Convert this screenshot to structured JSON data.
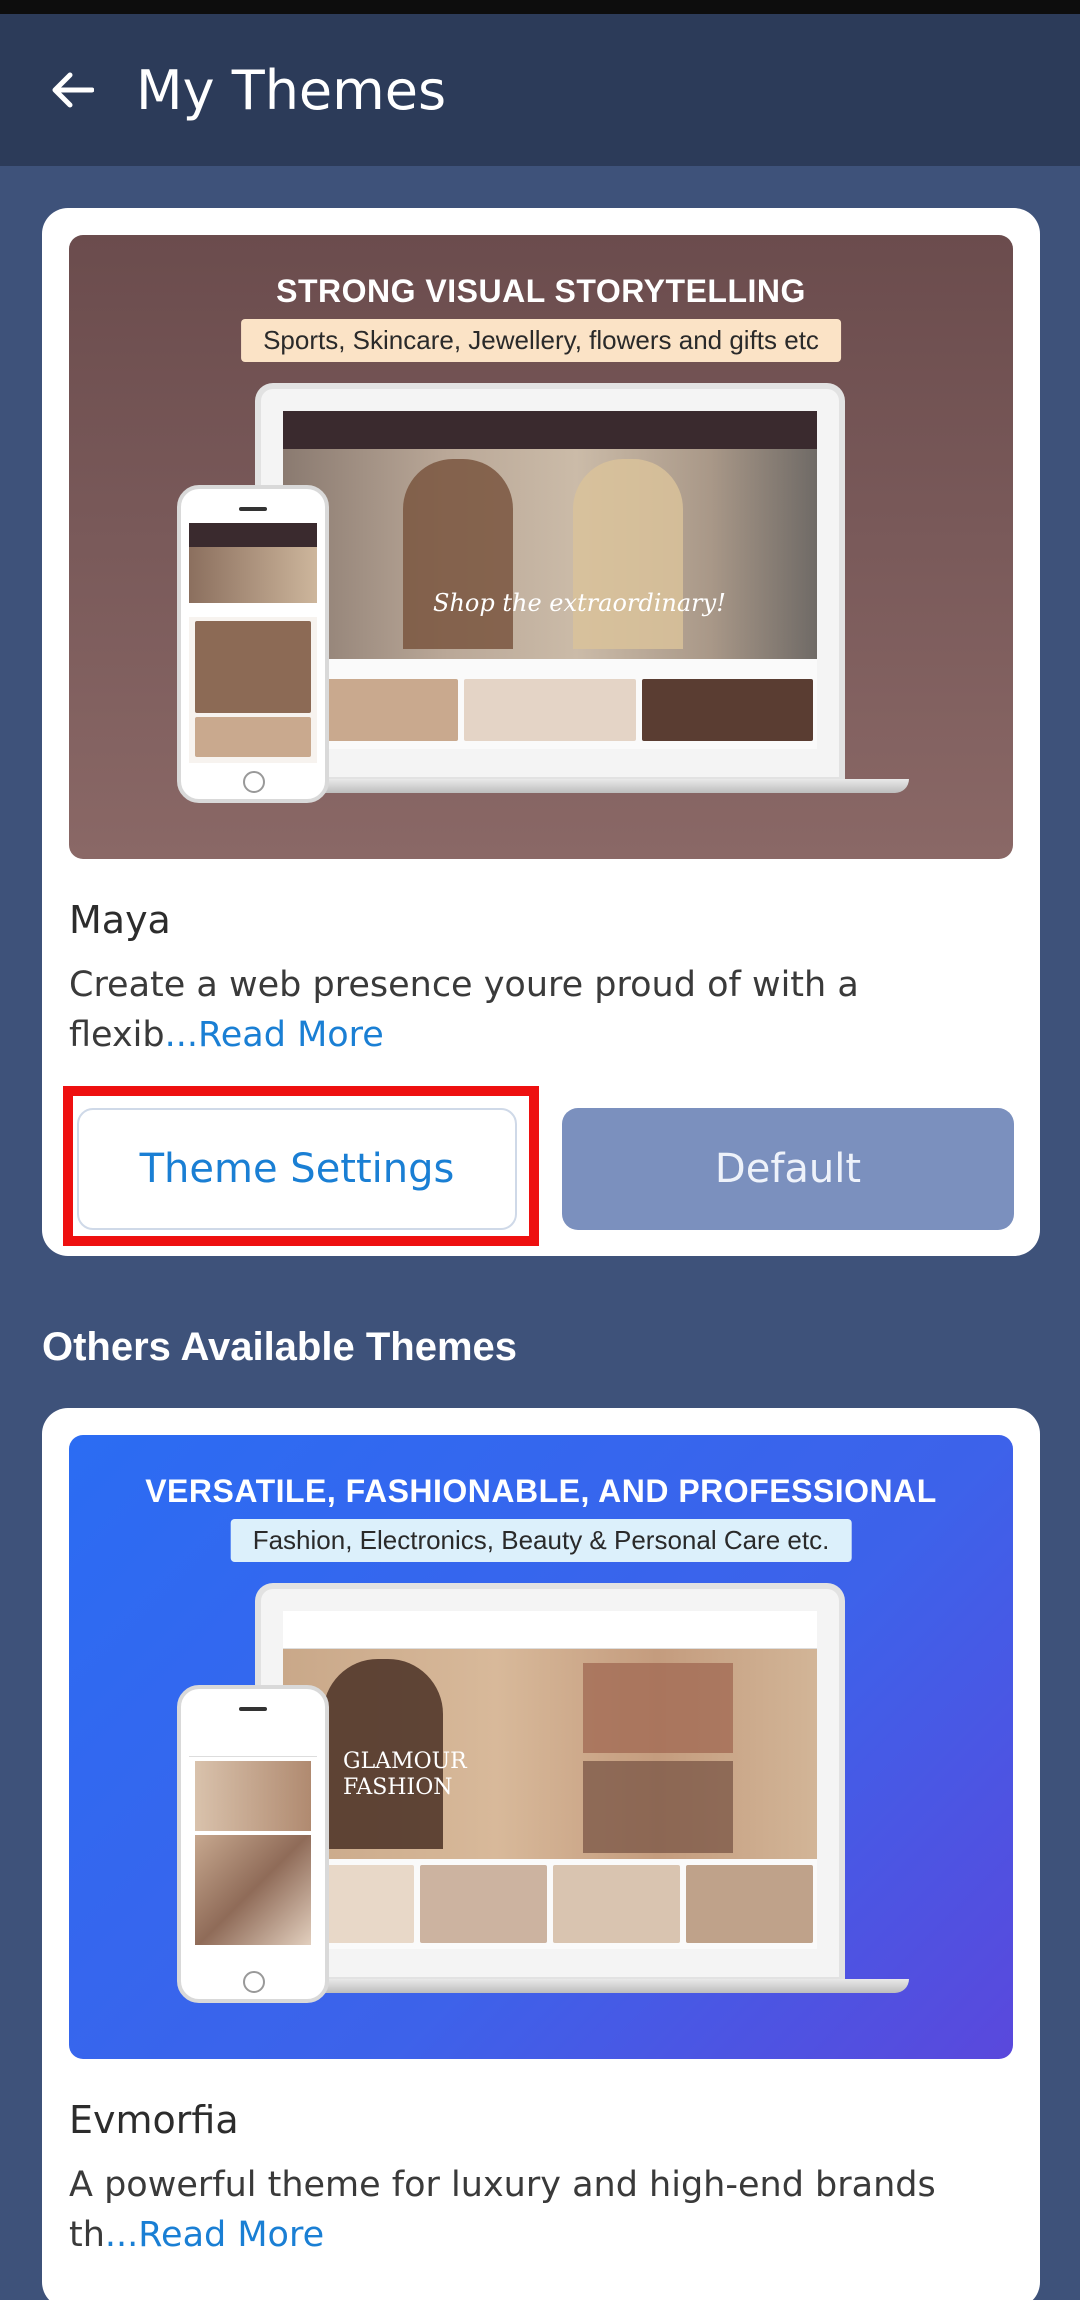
{
  "header": {
    "title": "My Themes",
    "back_icon": "arrow-left-icon"
  },
  "current_theme": {
    "banner": {
      "headline": "STRONG VISUAL STORYTELLING",
      "tagline": "Sports, Skincare, Jewellery, flowers and gifts etc",
      "hero_caption": "Shop the extraordinary!"
    },
    "name": "Maya",
    "description": "Create a web presence youre proud of with a flexib",
    "read_more": "...Read More",
    "settings_button": "Theme Settings",
    "default_button": "Default"
  },
  "others_section": {
    "title": "Others Available Themes"
  },
  "other_themes": [
    {
      "banner": {
        "headline": "VERSATILE, FASHIONABLE, AND PROFESSIONAL",
        "tagline": "Fashion, Electronics, Beauty & Personal Care etc.",
        "hero_caption": "GLAMOUR FASHION"
      },
      "name": "Evmorfia",
      "description": "A powerful theme for luxury and high-end brands th",
      "read_more": "...Read More"
    }
  ],
  "colors": {
    "page_bg": "#3e527a",
    "app_bar": "#2c3b59",
    "accent": "#1a7fd4",
    "default_button": "#7b90be",
    "highlight": "#ee1010"
  }
}
